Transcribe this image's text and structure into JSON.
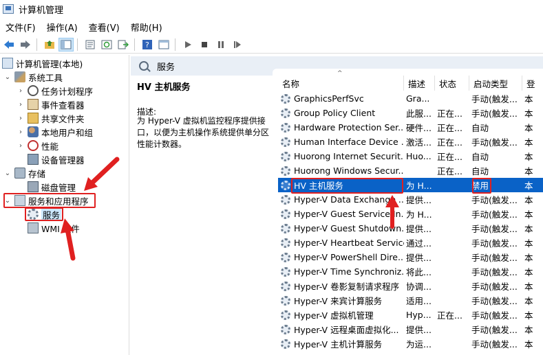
{
  "window": {
    "title": "计算机管理"
  },
  "menu": [
    "文件(F)",
    "操作(A)",
    "查看(V)",
    "帮助(H)"
  ],
  "toolbar": {
    "icons": [
      "back-icon",
      "forward-icon",
      "up-folder-icon",
      "show-tree-icon",
      "properties-icon",
      "refresh-icon",
      "export-icon",
      "help-icon",
      "console-icon",
      "play-icon",
      "stop-icon",
      "pause-icon",
      "restart-icon"
    ]
  },
  "tree": {
    "root": "计算机管理(本地)",
    "system_tools": "系统工具",
    "task_scheduler": "任务计划程序",
    "event_viewer": "事件查看器",
    "shared_folders": "共享文件夹",
    "local_users": "本地用户和组",
    "performance": "性能",
    "device_manager": "设备管理器",
    "storage": "存储",
    "disk_management": "磁盘管理",
    "services_apps": "服务和应用程序",
    "services": "服务",
    "wmi": "WMI 控件"
  },
  "services_header": "服务",
  "detail": {
    "title": "HV 主机服务",
    "desc_label": "描述:",
    "desc_text": "为 Hyper-V 虚拟机监控程序提供接口，以便为主机操作系统提供单分区性能计数器。"
  },
  "columns": {
    "name": "名称",
    "desc": "描述",
    "status": "状态",
    "start": "启动类型",
    "login": "登"
  },
  "rows": [
    {
      "name": "GraphicsPerfSvc",
      "desc": "Gra...",
      "status": "",
      "start": "手动(触发...",
      "login": "本"
    },
    {
      "name": "Group Policy Client",
      "desc": "此服...",
      "status": "正在...",
      "start": "手动(触发...",
      "login": "本"
    },
    {
      "name": "Hardware Protection Ser...",
      "desc": "硬件...",
      "status": "正在...",
      "start": "自动",
      "login": "本"
    },
    {
      "name": "Human Interface Device ...",
      "desc": "激活...",
      "status": "正在...",
      "start": "手动(触发...",
      "login": "本"
    },
    {
      "name": "Huorong Internet Securit...",
      "desc": "Huo...",
      "status": "正在...",
      "start": "自动",
      "login": "本"
    },
    {
      "name": "Huorong Windows Secur...",
      "desc": "",
      "status": "正在...",
      "start": "自动",
      "login": "本"
    },
    {
      "name": "HV 主机服务",
      "desc": "为 H...",
      "status": "",
      "start": "禁用",
      "login": "本"
    },
    {
      "name": "Hyper-V Data Exchange ...",
      "desc": "提供...",
      "status": "",
      "start": "手动(触发...",
      "login": "本"
    },
    {
      "name": "Hyper-V Guest Service In...",
      "desc": "为 H...",
      "status": "",
      "start": "手动(触发...",
      "login": "本"
    },
    {
      "name": "Hyper-V Guest Shutdown...",
      "desc": "提供...",
      "status": "",
      "start": "手动(触发...",
      "login": "本"
    },
    {
      "name": "Hyper-V Heartbeat Service",
      "desc": "通过...",
      "status": "",
      "start": "手动(触发...",
      "login": "本"
    },
    {
      "name": "Hyper-V PowerShell Dire...",
      "desc": "提供...",
      "status": "",
      "start": "手动(触发...",
      "login": "本"
    },
    {
      "name": "Hyper-V Time Synchroniz...",
      "desc": "将此...",
      "status": "",
      "start": "手动(触发...",
      "login": "本"
    },
    {
      "name": "Hyper-V 卷影复制请求程序",
      "desc": "协调...",
      "status": "",
      "start": "手动(触发...",
      "login": "本"
    },
    {
      "name": "Hyper-V 来宾计算服务",
      "desc": "适用...",
      "status": "",
      "start": "手动(触发...",
      "login": "本"
    },
    {
      "name": "Hyper-V 虚拟机管理",
      "desc": "Hyp...",
      "status": "正在...",
      "start": "手动(触发...",
      "login": "本"
    },
    {
      "name": "Hyper-V 远程桌面虚拟化...",
      "desc": "提供...",
      "status": "",
      "start": "手动(触发...",
      "login": "本"
    },
    {
      "name": "Hyper-V 主机计算服务",
      "desc": "为运...",
      "status": "",
      "start": "手动(触发...",
      "login": "本"
    }
  ],
  "colors": {
    "accent": "#0a62c7",
    "annotation": "#e02020"
  }
}
